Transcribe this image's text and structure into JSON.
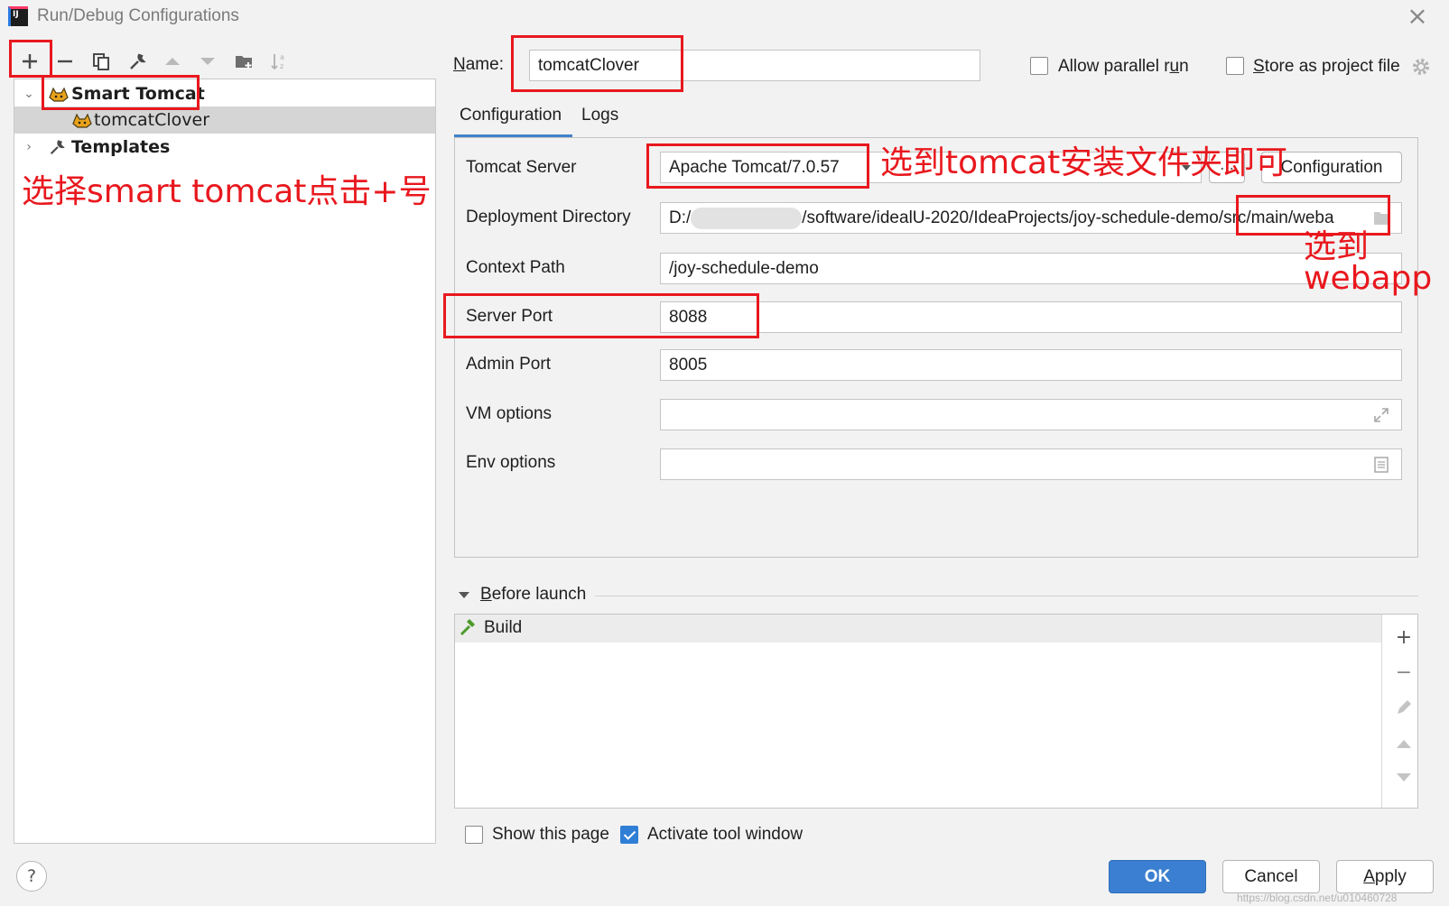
{
  "window": {
    "title": "Run/Debug Configurations",
    "app_logo": "IJ"
  },
  "toolbar": {
    "add_glyph": "+",
    "remove_glyph": "−"
  },
  "tree": {
    "smart_tomcat": "Smart Tomcat",
    "config_item": "tomcatClover",
    "templates": "Templates"
  },
  "name": {
    "label_prefix": "",
    "label_underlined": "N",
    "label_rest": "ame:",
    "value": "tomcatClover"
  },
  "options": {
    "allow_parallel": "Allow parallel r",
    "allow_parallel_u": "u",
    "allow_parallel_rest": "n",
    "store_u": "S",
    "store_rest": "tore as project file"
  },
  "tabs": {
    "configuration": "Configuration",
    "logs": "Logs"
  },
  "form": {
    "tomcat_server_label": "Tomcat Server",
    "tomcat_server_value": "Apache Tomcat/7.0.57",
    "browse_label": "...",
    "configuration_button": "Configuration",
    "deploy_label": "Deployment Directory",
    "deploy_prefix": "D:/",
    "deploy_value": "/software/idealU-2020/IdeaProjects/joy-schedule-demo/src/main/weba",
    "context_label": "Context Path",
    "context_value": "/joy-schedule-demo",
    "server_port_label": "Server Port",
    "server_port_value": "8088",
    "admin_port_label": "Admin Port",
    "admin_port_value": "8005",
    "vm_label": "VM options",
    "vm_value": "",
    "env_label": "Env options",
    "env_value": ""
  },
  "before_launch": {
    "title_u": "B",
    "title_rest": "efore launch",
    "items": [
      "Build"
    ]
  },
  "bottom": {
    "show_page": "Show this page",
    "activate_tool": "Activate tool window",
    "ok": "OK",
    "cancel": "Cancel",
    "apply_u": "A",
    "apply_rest": "pply",
    "help": "?",
    "watermark": "https://blog.csdn.net/u010460728"
  },
  "annotations": {
    "select_smart_tomcat": "选择smart tomcat点击+号",
    "select_tomcat_folder": "选到tomcat安装文件夹即可",
    "select_webapp_1": "选到",
    "select_webapp_2": "webapp"
  },
  "colors": {
    "accent": "#3a7fd1",
    "annotation_red": "#e8181e",
    "selection": "#d5d5d5"
  }
}
